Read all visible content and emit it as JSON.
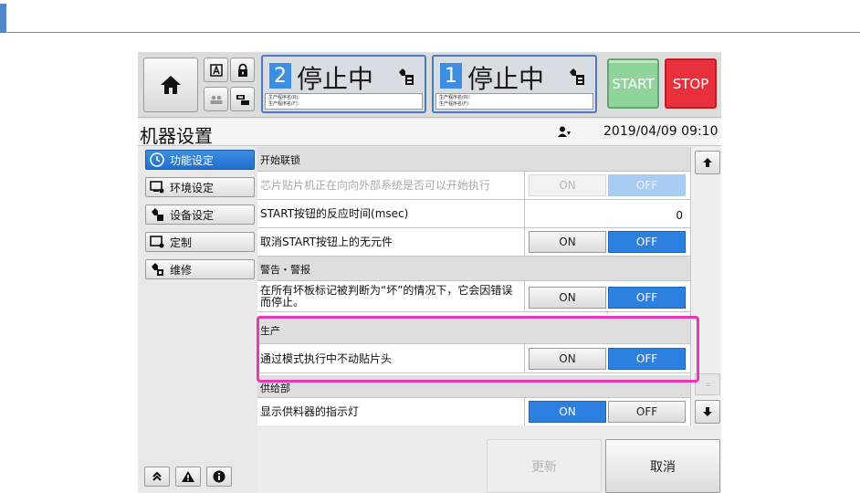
{
  "colors": {
    "accent": "#2d7fe0",
    "highlight": "#e838b8",
    "start": "#8fd49a",
    "stop": "#e8303c"
  },
  "topbar": {
    "lanes": [
      {
        "num": "2",
        "state": "停止中",
        "prog_r": "生产程序名(R)：",
        "prog_f": "生产程序名(F)："
      },
      {
        "num": "1",
        "state": "停止中",
        "prog_r": "生产程序名(R)：",
        "prog_f": "生产程序名(F)："
      }
    ],
    "start_label": "START",
    "stop_label": "STOP"
  },
  "header": {
    "title": "机器设置",
    "datetime": "2019/04/09 09:10"
  },
  "sidebar": {
    "items": [
      {
        "label": "功能设定",
        "icon": "function-settings-icon",
        "active": true
      },
      {
        "label": "环境设定",
        "icon": "environment-settings-icon",
        "active": false
      },
      {
        "label": "设备设定",
        "icon": "device-settings-icon",
        "active": false
      },
      {
        "label": "定制",
        "icon": "customize-icon",
        "active": false
      },
      {
        "label": "维修",
        "icon": "maintenance-icon",
        "active": false
      }
    ]
  },
  "toggle": {
    "on": "ON",
    "off": "OFF"
  },
  "settings": {
    "sec_start_interlock": "开始联锁",
    "chip_mounter_inquiry": "芯片贴片机正在向向外部系统是否可以开始执行",
    "start_response_time": "START按钮的反应时间(msec)",
    "start_response_value": "0",
    "cancel_no_component": "取消START按钮上的无元件",
    "sec_warning": "警告・警报",
    "stop_on_bad_mark": "在所有坏板标记被判断为“坏”的情况下，它会因错误而停止。",
    "sec_production": "生产",
    "pass_mode_no_head": "通过模式执行中不动贴片头",
    "sec_feeder": "供给部",
    "feeder_indicator": "显示供料器的指示灯"
  },
  "actions": {
    "update": "更新",
    "cancel": "取消"
  }
}
